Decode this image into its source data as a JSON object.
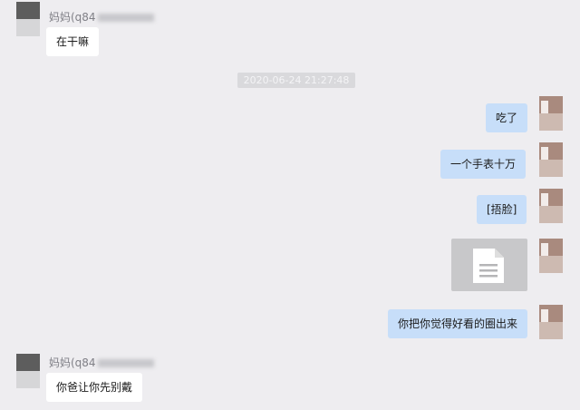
{
  "messages": {
    "sender_1": "妈妈(q84",
    "sender_2": "妈妈(q84",
    "in_1": "在干嘛",
    "in_2": "你爸让你先别戴",
    "timestamp": "2020-06-24 21:27:48",
    "out_1": "吃了",
    "out_2": "一个手表十万",
    "out_3": "[捂脸]",
    "out_4": "你把你觉得好看的圈出来"
  },
  "file_attachment": {
    "icon": "document-icon"
  },
  "colors": {
    "background": "#eeedf0",
    "incoming_bubble": "#ffffff",
    "outgoing_bubble": "#c7def9",
    "file_card": "#c8c8ca"
  }
}
